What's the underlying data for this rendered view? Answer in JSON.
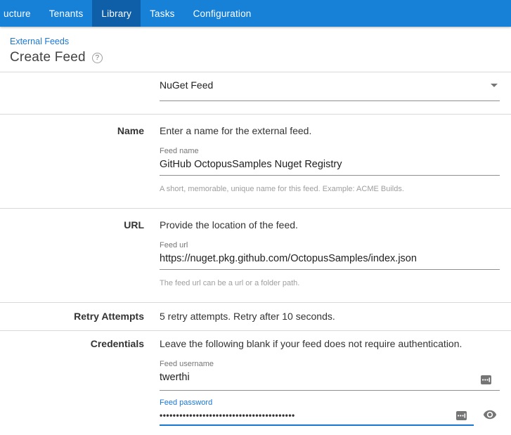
{
  "nav": {
    "items": [
      {
        "label": "ucture"
      },
      {
        "label": "Tenants"
      },
      {
        "label": "Library"
      },
      {
        "label": "Tasks"
      },
      {
        "label": "Configuration"
      }
    ],
    "active_item": "Library"
  },
  "header": {
    "breadcrumb": "External Feeds",
    "title": "Create Feed",
    "help_icon": "?"
  },
  "form": {
    "feed_type": {
      "value": "NuGet Feed"
    },
    "name": {
      "label": "Name",
      "description": "Enter a name for the external feed.",
      "field_label": "Feed name",
      "value": "GitHub OctopusSamples Nuget Registry",
      "helper": "A short, memorable, unique name for this feed. Example: ACME Builds."
    },
    "url": {
      "label": "URL",
      "description": "Provide the location of the feed.",
      "field_label": "Feed url",
      "value": "https://nuget.pkg.github.com/OctopusSamples/index.json",
      "helper": "The feed url can be a url or a folder path."
    },
    "retry": {
      "label": "Retry Attempts",
      "description": "5 retry attempts. Retry after 10 seconds."
    },
    "credentials": {
      "label": "Credentials",
      "description": "Leave the following blank if your feed does not require authentication.",
      "username": {
        "field_label": "Feed username",
        "value": "twerthi"
      },
      "password": {
        "field_label": "Feed password",
        "value_masked": "•••••••••••••••••••••••••••••••••••••••••"
      }
    }
  },
  "icons": {
    "help": "help-circle-icon",
    "dropdown": "chevron-down-icon",
    "autofill": "autofill-ellipsis-icon",
    "visibility": "eye-icon"
  },
  "colors": {
    "navbar": "#1781d8",
    "navbar_active": "#0e5fa8",
    "breadcrumb_link": "#1a77d2",
    "focus_accent": "#1976d2",
    "divider": "#d9d9d9",
    "underline": "#8f8f8f"
  }
}
